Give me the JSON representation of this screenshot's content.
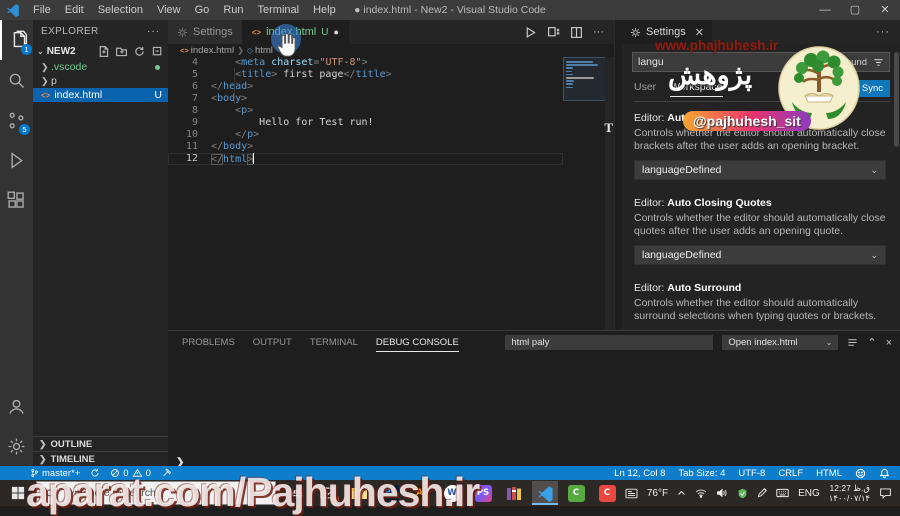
{
  "window": {
    "display_title": "● index.html - New2 - Visual Studio Code",
    "controls": {
      "minimize": "—",
      "maximize": "▢",
      "close": "✕"
    }
  },
  "menu_bar": {
    "items": [
      "File",
      "Edit",
      "Selection",
      "View",
      "Go",
      "Run",
      "Terminal",
      "Help"
    ]
  },
  "activity_bar": {
    "top": [
      {
        "id": "explorer",
        "badge": "1",
        "active": true
      },
      {
        "id": "search"
      },
      {
        "id": "source-control",
        "badge": "5"
      },
      {
        "id": "run-debug"
      },
      {
        "id": "extensions"
      }
    ],
    "bottom": [
      {
        "id": "account"
      },
      {
        "id": "settings-gear"
      }
    ]
  },
  "explorer": {
    "header": "EXPLORER",
    "more": "···",
    "root": "NEW2",
    "files": [
      {
        "label": ".vscode",
        "kind": "folder",
        "color": "#73c991",
        "dot": true
      },
      {
        "label": "p",
        "kind": "folder"
      },
      {
        "label": "index.html",
        "kind": "html",
        "git": "U",
        "selected": true
      }
    ],
    "sections": [
      {
        "label": "OUTLINE"
      },
      {
        "label": "TIMELINE"
      }
    ]
  },
  "editor": {
    "tabs": [
      {
        "label": "Settings",
        "icon": "gear"
      },
      {
        "label": "index.html",
        "icon": "html",
        "git": "U",
        "modified": true,
        "active": true
      }
    ],
    "breadcrumb": [
      {
        "label": "index.html"
      },
      {
        "label": "html"
      }
    ],
    "code_lines": [
      {
        "n": "4",
        "tokens": [
          [
            "ws",
            "    "
          ],
          [
            "p",
            "<"
          ],
          [
            "t",
            "meta"
          ],
          [
            "x",
            " "
          ],
          [
            "a",
            "charset"
          ],
          [
            "p",
            "="
          ],
          [
            "s",
            "\"UTF-8\""
          ],
          [
            "p",
            ">"
          ]
        ]
      },
      {
        "n": "5",
        "tokens": [
          [
            "ws",
            "    "
          ],
          [
            "p",
            "<"
          ],
          [
            "t",
            "title"
          ],
          [
            "p",
            ">"
          ],
          [
            "x",
            " first page"
          ],
          [
            "p",
            "</"
          ],
          [
            "t",
            "title"
          ],
          [
            "p",
            ">"
          ]
        ]
      },
      {
        "n": "6",
        "tokens": [
          [
            "p",
            "</"
          ],
          [
            "t",
            "head"
          ],
          [
            "p",
            ">"
          ]
        ]
      },
      {
        "n": "7",
        "tokens": [
          [
            "p",
            "<"
          ],
          [
            "t",
            "body"
          ],
          [
            "p",
            ">"
          ]
        ]
      },
      {
        "n": "8",
        "tokens": [
          [
            "ws",
            "    "
          ],
          [
            "p",
            "<"
          ],
          [
            "t",
            "p"
          ],
          [
            "p",
            ">"
          ]
        ]
      },
      {
        "n": "9",
        "tokens": [
          [
            "ws",
            "        "
          ],
          [
            "x",
            "Hello for Test run!"
          ]
        ]
      },
      {
        "n": "10",
        "tokens": [
          [
            "ws",
            "    "
          ],
          [
            "p",
            "</"
          ],
          [
            "t",
            "p"
          ],
          [
            "p",
            ">"
          ]
        ]
      },
      {
        "n": "11",
        "tokens": [
          [
            "p",
            "</"
          ],
          [
            "t",
            "body"
          ],
          [
            "p",
            ">"
          ]
        ]
      },
      {
        "n": "12",
        "tokens": [
          [
            "pb",
            "</"
          ],
          [
            "t",
            "html"
          ],
          [
            "pb",
            ">"
          ]
        ],
        "current": true
      }
    ]
  },
  "settings_panel": {
    "tab_label": "Settings",
    "close_glyph": "✕",
    "more": "···",
    "search_value": "langu",
    "results_label": "Settings Found",
    "scope_tabs": [
      {
        "label": "User"
      },
      {
        "label": "Workspace",
        "active": true
      }
    ],
    "sync_button": "Turn on Settings Sync",
    "items": [
      {
        "category": "Editor:",
        "title": "Auto Closing Brackets",
        "desc": "Controls whether the editor should automatically close brackets after the user adds an opening bracket.",
        "value": "languageDefined"
      },
      {
        "category": "Editor:",
        "title": "Auto Closing Quotes",
        "desc": "Controls whether the editor should automatically close quotes after the user adds an opening quote.",
        "value": "languageDefined"
      },
      {
        "category": "Editor:",
        "title": "Auto Surround",
        "desc": "Controls whether the editor should automatically surround selections when typing quotes or brackets.",
        "value": "languageDefined"
      }
    ]
  },
  "panel": {
    "tabs": [
      {
        "label": "PROBLEMS"
      },
      {
        "label": "OUTPUT"
      },
      {
        "label": "TERMINAL"
      },
      {
        "label": "DEBUG CONSOLE",
        "active": true
      }
    ],
    "filter_value": "html paly",
    "dropdown_value": "Open index.html",
    "expand_chevron": "❯"
  },
  "status_bar": {
    "branch": "master*+",
    "errors": "0",
    "warnings": "0",
    "right_items": [
      "Ln 12, Col 8",
      "Tab Size: 4",
      "UTF-8",
      "CRLF",
      "HTML"
    ]
  },
  "taskbar": {
    "search_placeholder": "Type here to search",
    "apps": [
      {
        "id": "task-view"
      },
      {
        "id": "mail",
        "badge": "1"
      },
      {
        "id": "file-explorer"
      },
      {
        "id": "photoshop",
        "label": "Ps",
        "bg": "#001e36",
        "fg": "#31a8ff"
      },
      {
        "id": "illustrator",
        "label": "Ai",
        "bg": "#331c00",
        "fg": "#ff9a00"
      },
      {
        "id": "word",
        "label": "W",
        "bg": "#ffffff",
        "fg": "#2b579a",
        "round": true
      },
      {
        "id": "phpstorm",
        "label": "PS",
        "bg": "linear-gradient(135deg,#b345f1,#765af8,#ef3f7c)",
        "fg": "#ffffff"
      },
      {
        "id": "winrar"
      },
      {
        "id": "vscode",
        "active": true
      },
      {
        "id": "camtasia",
        "label": "C",
        "bg": "#58a942",
        "fg": "#ffffff"
      },
      {
        "id": "adobe-red",
        "label": "C",
        "bg": "#e8483f",
        "fg": "#ffffff"
      }
    ],
    "tray": {
      "weather": "76°F",
      "language": "ENG",
      "time": "12:27 ق.ظ",
      "date": "۱۴۰۰/۰۷/۱۴"
    }
  },
  "watermarks": {
    "url_top": "www.phajhuhesh.ir",
    "persian": "پژوهش",
    "instagram": "@pajhuhesh_sit",
    "bottom": "aparat.com/Pajhuhesh.ir",
    "stray": "T"
  },
  "colors": {
    "statusbar": "#0d7dcc",
    "selection": "#0a64ad",
    "untracked": "#73c991",
    "button": "#1177bb",
    "tag": "#569cd6",
    "string": "#ce9178",
    "attr": "#9cdcfe"
  }
}
